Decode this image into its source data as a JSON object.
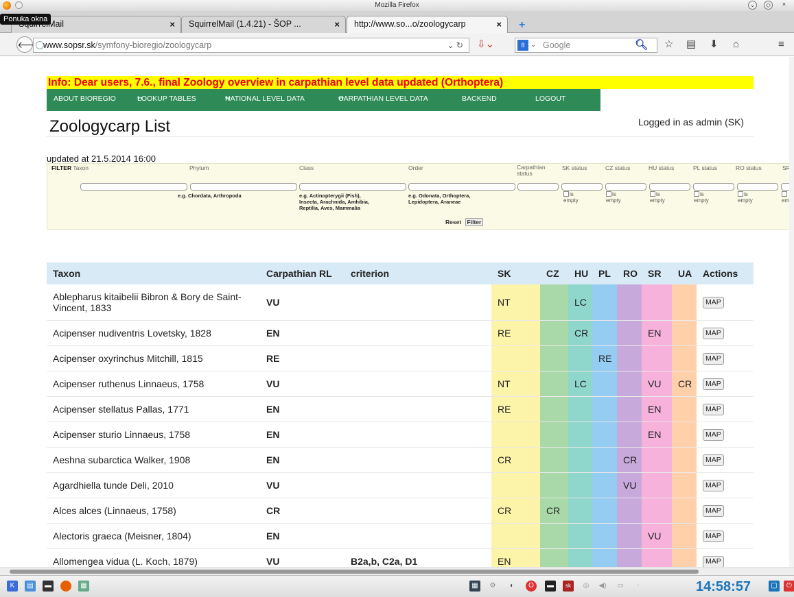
{
  "window": {
    "title": "Mozilla Firefox",
    "tooltip": "Ponuka okna"
  },
  "tabs": [
    {
      "label": "SquirrelMail",
      "close": "×"
    },
    {
      "label": "SquirrelMail (1.4.21) - ŠOP ...",
      "close": "×"
    },
    {
      "label": "http://www.so...o/zoologycarp",
      "close": "×"
    }
  ],
  "newtab": "+",
  "nav": {
    "url_domain": "www.sopsr.sk",
    "url_path": "/symfony-bioregio/zoologycarp",
    "search_placeholder": "Google",
    "search_engine": "8"
  },
  "info": "Info: Dear users, 7.6., final Zoology overview in carpathian level data updated (Orthoptera)",
  "menu": {
    "about": "ABOUT BIOREGIO",
    "lookup": "LOOKUP TABLES",
    "national": "NATIONAL LEVEL DATA",
    "carpathian": "CARPATHIAN LEVEL DATA",
    "backend": "BACKEND",
    "logout": "LOGOUT"
  },
  "page": {
    "title": "Zoologycarp List",
    "logged_in": "Logged in as admin (SK)",
    "updated": "updated at 21.5.2014 16:00"
  },
  "filter": {
    "label": "FILTER",
    "taxon": "Taxon",
    "phylum": "Phylum",
    "class": "Class",
    "order": "Order",
    "carp_status": "Carpathian status",
    "sk": "SK status",
    "cz": "CZ status",
    "hu": "HU status",
    "pl": "PL status",
    "ro": "RO status",
    "sr": "SR",
    "phylum_hint": "e.g. Chordata, Arthropoda",
    "class_hint_1": "e.g. Actinopterygii (Fish),",
    "class_hint_2": "Insecta, Arachnida, Amhibia,",
    "class_hint_3": "Reptilia, Aves, Mammalia",
    "order_hint_1": "e.g. Odonata, Orthoptera,",
    "order_hint_2": "Lepidoptera, Araneae",
    "is": "is",
    "empty": "empty",
    "empty_trunc": "em",
    "reset": "Reset",
    "filter_btn": "Filter"
  },
  "table": {
    "headers": {
      "taxon": "Taxon",
      "carp": "Carpathian RL",
      "criterion": "criterion",
      "sk": "SK",
      "cz": "CZ",
      "hu": "HU",
      "pl": "PL",
      "ro": "RO",
      "sr": "SR",
      "ua": "UA",
      "actions": "Actions"
    },
    "map_label": "MAP",
    "rows": [
      {
        "taxon": "Ablepharus kitaibelii Bibron & Bory de Saint-Vincent, 1833",
        "carp": "VU",
        "criterion": "",
        "sk": "NT",
        "cz": "",
        "hu": "LC",
        "pl": "",
        "ro": "",
        "sr": "",
        "ua": ""
      },
      {
        "taxon": "Acipenser nudiventris Lovetsky, 1828",
        "carp": "EN",
        "criterion": "",
        "sk": "RE",
        "cz": "",
        "hu": "CR",
        "pl": "",
        "ro": "",
        "sr": "EN",
        "ua": ""
      },
      {
        "taxon": "Acipenser oxyrinchus Mitchill, 1815",
        "carp": "RE",
        "criterion": "",
        "sk": "",
        "cz": "",
        "hu": "",
        "pl": "RE",
        "ro": "",
        "sr": "",
        "ua": ""
      },
      {
        "taxon": "Acipenser ruthenus Linnaeus, 1758",
        "carp": "VU",
        "criterion": "",
        "sk": "NT",
        "cz": "",
        "hu": "LC",
        "pl": "",
        "ro": "",
        "sr": "VU",
        "ua": "CR"
      },
      {
        "taxon": "Acipenser stellatus Pallas, 1771",
        "carp": "EN",
        "criterion": "",
        "sk": "RE",
        "cz": "",
        "hu": "",
        "pl": "",
        "ro": "",
        "sr": "EN",
        "ua": ""
      },
      {
        "taxon": "Acipenser sturio Linnaeus, 1758",
        "carp": "EN",
        "criterion": "",
        "sk": "",
        "cz": "",
        "hu": "",
        "pl": "",
        "ro": "",
        "sr": "EN",
        "ua": ""
      },
      {
        "taxon": "Aeshna subarctica Walker, 1908",
        "carp": "EN",
        "criterion": "",
        "sk": "CR",
        "cz": "",
        "hu": "",
        "pl": "",
        "ro": "CR",
        "sr": "",
        "ua": ""
      },
      {
        "taxon": "Agardhiella tunde Deli, 2010",
        "carp": "VU",
        "criterion": "",
        "sk": "",
        "cz": "",
        "hu": "",
        "pl": "",
        "ro": "VU",
        "sr": "",
        "ua": ""
      },
      {
        "taxon": "Alces alces (Linnaeus, 1758)",
        "carp": "CR",
        "criterion": "",
        "sk": "CR",
        "cz": "CR",
        "hu": "",
        "pl": "",
        "ro": "",
        "sr": "",
        "ua": ""
      },
      {
        "taxon": "Alectoris graeca (Meisner, 1804)",
        "carp": "EN",
        "criterion": "",
        "sk": "",
        "cz": "",
        "hu": "",
        "pl": "",
        "ro": "",
        "sr": "VU",
        "ua": ""
      },
      {
        "taxon": "Allomengea vidua (L. Koch, 1879)",
        "carp": "VU",
        "criterion": "B2a,b, C2a, D1",
        "sk": "EN",
        "cz": "",
        "hu": "",
        "pl": "",
        "ro": "",
        "sr": "",
        "ua": ""
      },
      {
        "taxon": "",
        "carp": "",
        "criterion": "",
        "sk": "",
        "cz": "",
        "hu": "",
        "pl": "",
        "ro": "",
        "sr": "",
        "ua": ""
      }
    ]
  },
  "taskbar": {
    "clock": "14:58:57"
  },
  "colors": {
    "sk": "#fcf4a8",
    "cz": "#a9d9a9",
    "hu": "#8fd6cc",
    "pl": "#94ccf2",
    "ro": "#c7a9dc",
    "sr": "#f7b2dc",
    "ua": "#ffd0aa",
    "menu": "#2e8b57",
    "info_bg": "#ffff00",
    "info_text": "#ee0000"
  }
}
